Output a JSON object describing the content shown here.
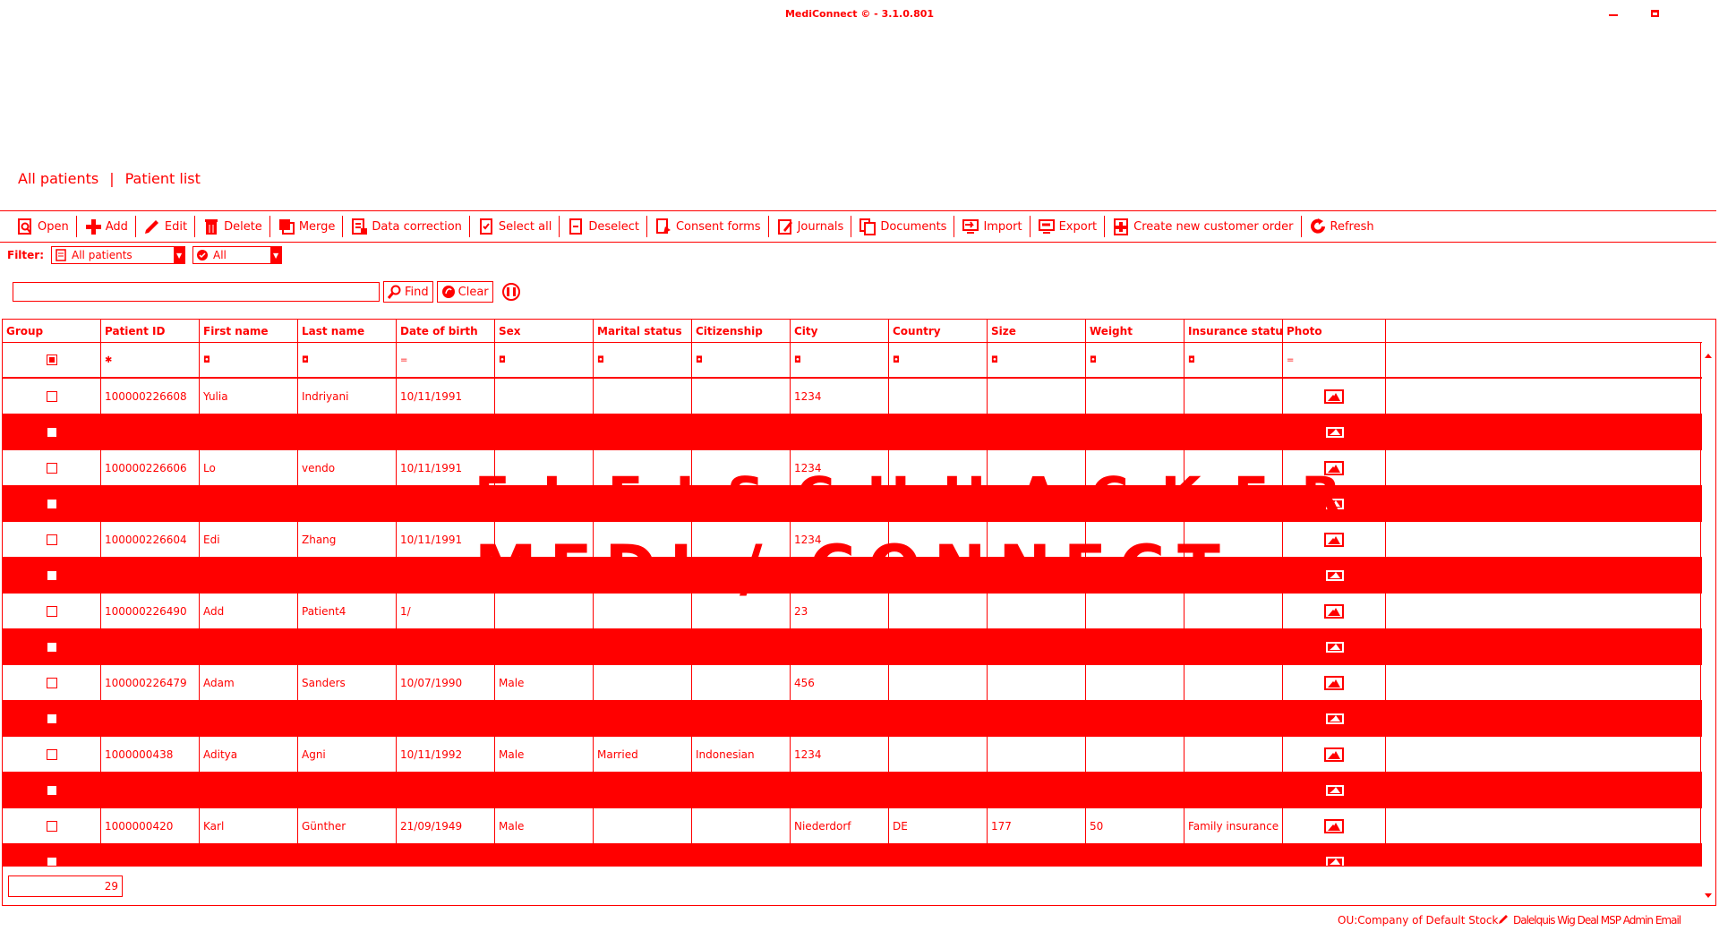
{
  "window": {
    "title": "MediConnect © - 3.1.0.801"
  },
  "breadcrumb": [
    "All patients",
    "|",
    "Patient list"
  ],
  "toolbar": [
    {
      "label": "Open",
      "icon": "open-icon"
    },
    {
      "label": "Add",
      "icon": "add-icon"
    },
    {
      "label": "Edit",
      "icon": "edit-icon"
    },
    {
      "label": "Delete",
      "icon": "delete-icon"
    },
    {
      "label": "Merge",
      "icon": "merge-icon"
    },
    {
      "label": "Data correction",
      "icon": "data-correction-icon"
    },
    {
      "label": "Select all",
      "icon": "select-all-icon"
    },
    {
      "label": "Deselect",
      "icon": "deselect-icon"
    },
    {
      "label": "Consent forms",
      "icon": "consent-forms-icon"
    },
    {
      "label": "Journals",
      "icon": "journals-icon"
    },
    {
      "label": "Documents",
      "icon": "documents-icon"
    },
    {
      "label": "Import",
      "icon": "import-icon"
    },
    {
      "label": "Export",
      "icon": "export-icon"
    },
    {
      "label": "Create new customer order",
      "icon": "new-order-icon"
    },
    {
      "label": "Refresh",
      "icon": "refresh-icon"
    }
  ],
  "filter": {
    "label": "Filter:",
    "select1": "All patients",
    "select2": "All"
  },
  "search": {
    "value": "",
    "find_label": "Find",
    "clear_label": "Clear"
  },
  "columns": [
    "Group",
    "Patient ID",
    "First name",
    "Last name",
    "Date of birth",
    "Sex",
    "Marital status",
    "Citizenship",
    "City",
    "Country",
    "Size",
    "Weight",
    "Insurance status",
    "Photo"
  ],
  "filter_row": [
    "",
    "",
    "",
    "",
    "=",
    "",
    "",
    "",
    "",
    "",
    "",
    "",
    "",
    "="
  ],
  "rows": [
    {
      "id": "100000226608",
      "first": "Yulia",
      "last": "Indriyani",
      "dob": "10/11/1991",
      "sex": "",
      "marital": "",
      "citizenship": "",
      "city": "1234",
      "country": "",
      "size": "",
      "weight": "",
      "insurance": ""
    },
    {
      "id": "100000226606",
      "first": "Lo",
      "last": "vendo",
      "dob": "10/11/1991",
      "sex": "",
      "marital": "",
      "citizenship": "",
      "city": "1234",
      "country": "",
      "size": "",
      "weight": "",
      "insurance": ""
    },
    {
      "id": "100000226604",
      "first": "Edi",
      "last": "Zhang",
      "dob": "10/11/1991",
      "sex": "",
      "marital": "",
      "citizenship": "",
      "city": "1234",
      "country": "",
      "size": "",
      "weight": "",
      "insurance": ""
    },
    {
      "id": "100000226490",
      "first": "Add",
      "last": "Patient4",
      "dob": "1/",
      "sex": "",
      "marital": "",
      "citizenship": "",
      "city": "23",
      "country": "",
      "size": "",
      "weight": "",
      "insurance": ""
    },
    {
      "id": "100000226479",
      "first": "Adam",
      "last": "Sanders",
      "dob": "10/07/1990",
      "sex": "Male",
      "marital": "",
      "citizenship": "",
      "city": "456",
      "country": "",
      "size": "",
      "weight": "",
      "insurance": ""
    },
    {
      "id": "1000000438",
      "first": "Aditya",
      "last": "Agni",
      "dob": "10/11/1992",
      "sex": "Male",
      "marital": "Married",
      "citizenship": "Indonesian",
      "city": "1234",
      "country": "",
      "size": "",
      "weight": "",
      "insurance": ""
    },
    {
      "id": "1000000420",
      "first": "Karl",
      "last": "Günther",
      "dob": "21/09/1949",
      "sex": "Male",
      "marital": "",
      "citizenship": "",
      "city": "Niederdorf",
      "country": "DE",
      "size": "177",
      "weight": "50",
      "insurance": "Family insurance"
    }
  ],
  "count": "29",
  "watermark": {
    "line1": "FLEISCHHACKER",
    "line2": "MEDI / CONNECT"
  },
  "status": {
    "ou": "OU:Company of Default Stock",
    "user": "Dalelquis Wig Deal MSP Admin Email"
  },
  "colors": {
    "accent": "#ff0000"
  }
}
